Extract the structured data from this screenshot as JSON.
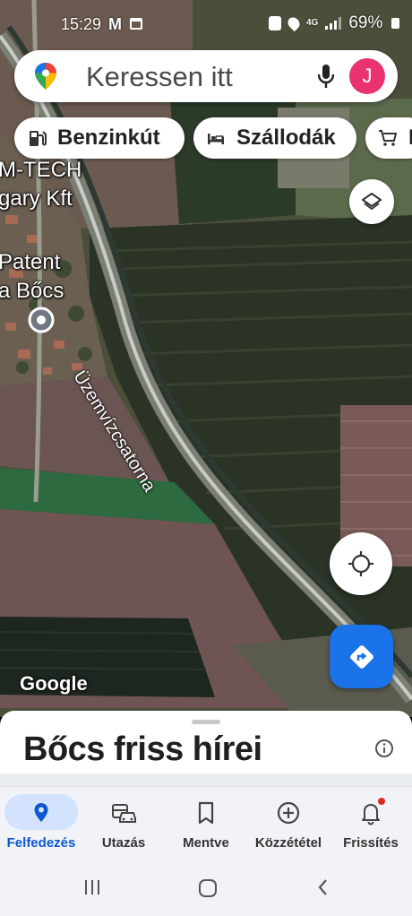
{
  "status_bar": {
    "time": "15:29",
    "mail_indicator": "M",
    "network": "4G",
    "battery": "69%"
  },
  "search": {
    "placeholder": "Keressen itt",
    "avatar_initial": "J"
  },
  "chips": [
    {
      "label": "Benzinkút",
      "icon": "gas-station-icon"
    },
    {
      "label": "Szállodák",
      "icon": "hotel-icon"
    },
    {
      "label": "É",
      "icon": "shopping-cart-icon"
    }
  ],
  "map": {
    "labels": [
      "M-TECH",
      "gary Kft",
      "Patent",
      "a Bőcs"
    ],
    "road_label": "Üzemvízcsatorna",
    "attribution": "Google"
  },
  "sheet": {
    "title": "Bőcs friss hírei"
  },
  "bottom_nav": {
    "items": [
      {
        "label": "Felfedezés",
        "icon": "location-pin-icon",
        "active": true
      },
      {
        "label": "Utazás",
        "icon": "commute-icon",
        "active": false
      },
      {
        "label": "Mentve",
        "icon": "bookmark-icon",
        "active": false
      },
      {
        "label": "Közzététel",
        "icon": "add-circle-icon",
        "active": false
      },
      {
        "label": "Frissítés",
        "icon": "bell-icon",
        "active": false
      }
    ]
  },
  "colors": {
    "accent": "#1a73e8",
    "active_nav_text": "#0b57d0",
    "active_nav_pill": "#d3e3fd",
    "avatar": "#e8336e"
  }
}
